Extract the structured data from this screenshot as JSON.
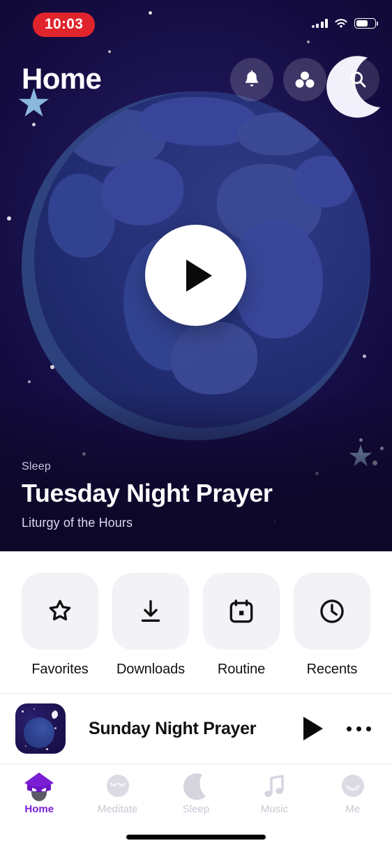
{
  "status_bar": {
    "time": "10:03",
    "time_pill_color": "#E0242C",
    "signal_icon": "cellular-signal-icon",
    "wifi_icon": "wifi-icon",
    "battery_icon": "battery-icon",
    "battery_level_pct": 62
  },
  "header": {
    "title": "Home",
    "actions": [
      {
        "name": "notifications-button",
        "icon": "bell-icon"
      },
      {
        "name": "community-button",
        "icon": "three-circles-icon"
      },
      {
        "name": "search-button",
        "icon": "search-icon"
      }
    ]
  },
  "hero": {
    "artwork": "earth-globe-night-illustration",
    "play_button_icon": "play-icon",
    "category": "Sleep",
    "title": "Tuesday Night Prayer",
    "subtitle": "Liturgy of the Hours",
    "background_color": "#1B1150"
  },
  "quick_actions": [
    {
      "label": "Favorites",
      "icon": "star-icon"
    },
    {
      "label": "Downloads",
      "icon": "download-icon"
    },
    {
      "label": "Routine",
      "icon": "calendar-icon"
    },
    {
      "label": "Recents",
      "icon": "clock-icon"
    }
  ],
  "now_playing": {
    "title": "Sunday Night Prayer",
    "thumbnail": "night-planet-artwork",
    "play_icon": "play-icon",
    "more_icon": "more-horizontal-icon"
  },
  "tab_bar": {
    "active_color": "#7B1FD4",
    "inactive_color": "#C9C7D2",
    "items": [
      {
        "label": "Home",
        "icon": "home-character-icon",
        "active": true
      },
      {
        "label": "Meditate",
        "icon": "meditating-face-icon",
        "active": false
      },
      {
        "label": "Sleep",
        "icon": "crescent-moon-icon",
        "active": false
      },
      {
        "label": "Music",
        "icon": "music-note-icon",
        "active": false
      },
      {
        "label": "Me",
        "icon": "smiling-face-icon",
        "active": false
      }
    ]
  }
}
